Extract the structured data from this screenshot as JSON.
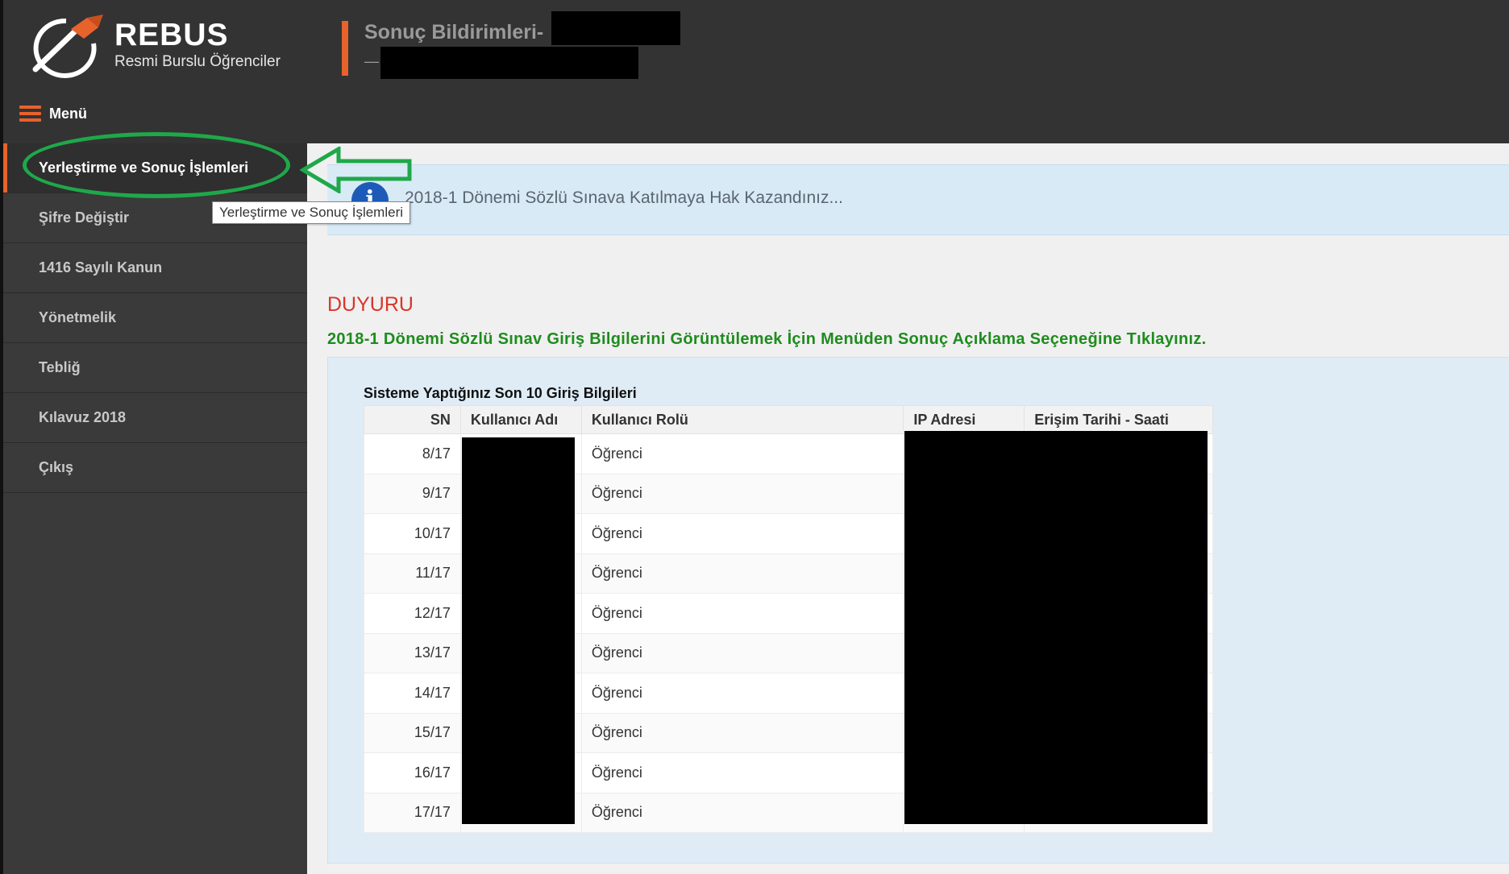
{
  "header": {
    "brand_name": "REBUS",
    "brand_subtitle": "Resmi Burslu Öğrenciler",
    "page_title": "Sonuç Bildirimleri-",
    "page_subtitle": "—",
    "menu_label": "Menü"
  },
  "sidebar": {
    "items": [
      {
        "label": "Yerleştirme ve Sonuç İşlemleri",
        "active": true
      },
      {
        "label": "Şifre Değiştir"
      },
      {
        "label": "1416 Sayılı Kanun"
      },
      {
        "label": "Yönetmelik"
      },
      {
        "label": "Tebliğ"
      },
      {
        "label": "Kılavuz 2018"
      },
      {
        "label": "Çıkış"
      }
    ]
  },
  "tooltip": "Yerleştirme ve Sonuç İşlemleri",
  "info": {
    "icon": "info-icon",
    "icon_glyph": "i",
    "text": "2018-1 Dönemi Sözlü Sınava Katılmaya Hak Kazandınız..."
  },
  "announcement": {
    "title": "DUYURU",
    "text": "2018-1 Dönemi Sözlü Sınav Giriş Bilgilerini Görüntülemek İçin Menüden Sonuç Açıklama Seçeneğine Tıklayınız."
  },
  "login_table": {
    "caption": "Sisteme Yaptığınız Son 10 Giriş Bilgileri",
    "columns": [
      "SN",
      "Kullanıcı Adı",
      "Kullanıcı Rolü",
      "IP Adresi",
      "Erişim Tarihi - Saati"
    ],
    "rows": [
      {
        "sn": "8/17",
        "role": "Öğrenci"
      },
      {
        "sn": "9/17",
        "role": "Öğrenci"
      },
      {
        "sn": "10/17",
        "role": "Öğrenci"
      },
      {
        "sn": "11/17",
        "role": "Öğrenci"
      },
      {
        "sn": "12/17",
        "role": "Öğrenci"
      },
      {
        "sn": "13/17",
        "role": "Öğrenci"
      },
      {
        "sn": "14/17",
        "role": "Öğrenci"
      },
      {
        "sn": "15/17",
        "role": "Öğrenci"
      },
      {
        "sn": "16/17",
        "role": "Öğrenci"
      },
      {
        "sn": "17/17",
        "role": "Öğrenci"
      }
    ]
  },
  "colors": {
    "accent": "#e8622c",
    "header_bg": "#333333",
    "sidebar_bg": "#3a3a3a",
    "annotation_green": "#1fa84a",
    "announcement_title": "#d9362b",
    "announcement_text": "#1e8c1e",
    "info_bg": "#d8eaf6"
  }
}
